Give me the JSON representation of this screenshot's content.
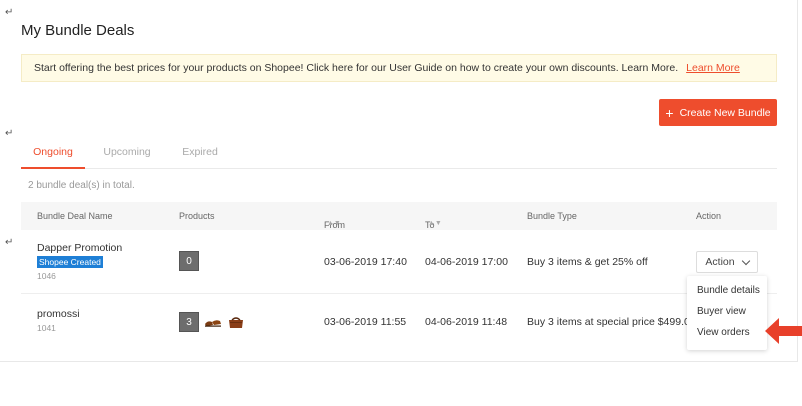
{
  "page": {
    "title": "My Bundle Deals"
  },
  "notice": {
    "text": "Start offering the best prices for your products on Shopee! Click here for our User Guide on how to create your own discounts. Learn More.",
    "link": "Learn More"
  },
  "create_button": {
    "icon": "plus-icon",
    "label": "Create New Bundle"
  },
  "tabs": [
    {
      "label": "Ongoing",
      "active": true
    },
    {
      "label": "Upcoming",
      "active": false
    },
    {
      "label": "Expired",
      "active": false
    }
  ],
  "total_text": "2 bundle deal(s) in total.",
  "table": {
    "headers": {
      "name": "Bundle Deal Name",
      "products": "Products",
      "from": "From",
      "to": "To",
      "type": "Bundle Type",
      "action": "Action"
    },
    "rows": [
      {
        "name": "Dapper Promotion",
        "badge": "Shopee Created",
        "id": "1046",
        "product_count": "0",
        "from": "03-06-2019 17:40",
        "to": "04-06-2019 17:00",
        "type": "Buy 3 items & get 25% off",
        "action": "Action"
      },
      {
        "name": "promossi",
        "id": "1041",
        "product_count": "3",
        "from": "03-06-2019 11:55",
        "to": "04-06-2019 11:48",
        "type": "Buy 3 items at special price $499.00"
      }
    ]
  },
  "action_menu": {
    "items": [
      "Bundle details",
      "Buyer view",
      "View orders"
    ]
  },
  "colors": {
    "accent": "#ee4d2d",
    "badge": "#1e7fd6",
    "notice_bg": "#fffbe6",
    "annotation_arrow": "#e8402a"
  }
}
